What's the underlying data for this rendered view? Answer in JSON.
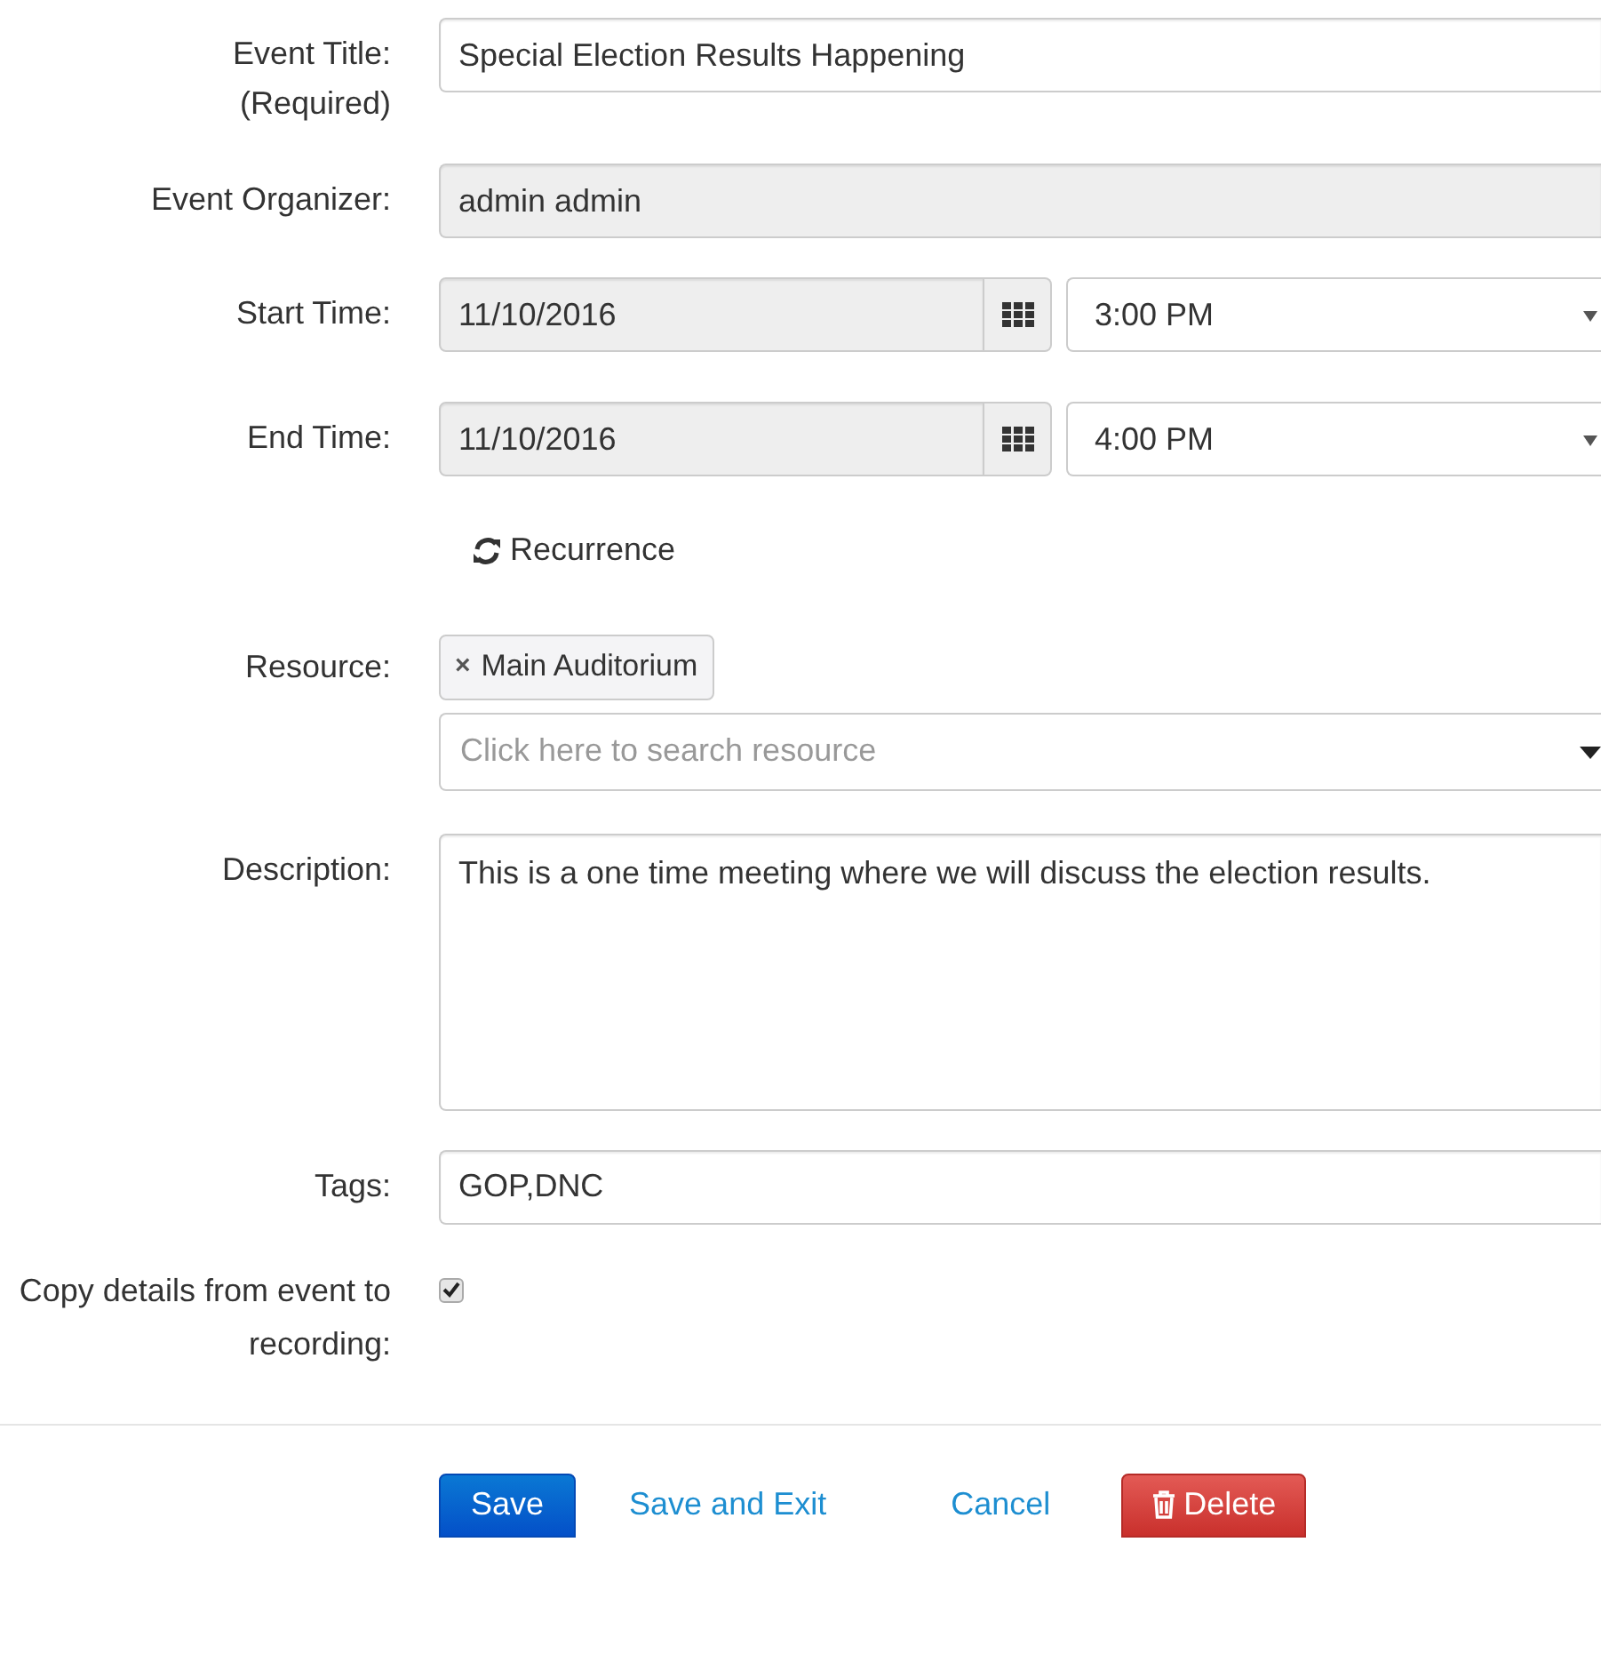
{
  "fields": [
    {
      "kind": "text",
      "label": "Event Title:",
      "sublabel": "(Required)",
      "value": "Special Election Results Happening"
    },
    {
      "kind": "readonly",
      "label": "Event Organizer:",
      "value": "admin admin"
    },
    {
      "kind": "datetime",
      "label": "Start Time:",
      "date": "11/10/2016",
      "time": "3:00 PM"
    },
    {
      "kind": "datetime",
      "label": "End Time:",
      "date": "11/10/2016",
      "time": "4:00 PM"
    },
    {
      "kind": "recurrence",
      "label": "Recurrence"
    },
    {
      "kind": "resource",
      "label": "Resource:",
      "tags": [
        "Main Auditorium"
      ],
      "remove": "×",
      "placeholder": "Click here to search resource"
    },
    {
      "kind": "textarea",
      "label": "Description:",
      "value": "This is a one time meeting where we will discuss the election results."
    },
    {
      "kind": "text",
      "label": "Tags:",
      "value": "GOP,DNC"
    },
    {
      "kind": "checkbox",
      "label": "Copy details from event to recording:",
      "checked": true
    }
  ],
  "buttons": [
    {
      "kind": "primary",
      "label": "Save"
    },
    {
      "kind": "link",
      "label": "Save and Exit"
    },
    {
      "kind": "link",
      "label": "Cancel"
    },
    {
      "kind": "danger",
      "label": "Delete"
    }
  ]
}
